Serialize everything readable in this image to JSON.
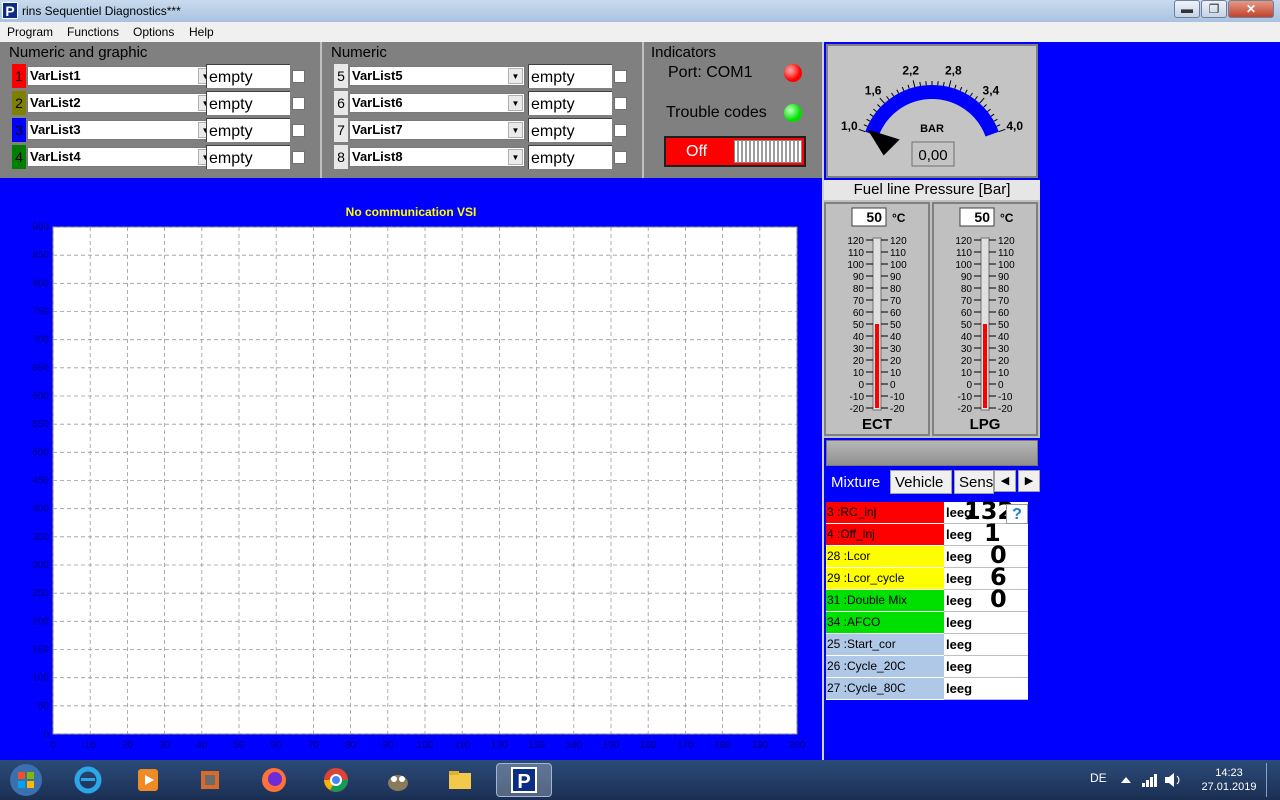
{
  "window": {
    "icon_letter": "P",
    "title": "rins Sequentiel Diagnostics***",
    "min_label": "▬",
    "max_label": "❐",
    "close_label": "✕"
  },
  "menu": [
    "Program",
    "Functions",
    "Options",
    "Help"
  ],
  "groups": {
    "numeric_graphic": {
      "title": "Numeric and graphic",
      "rows": [
        {
          "num": "1",
          "color": "#ff0000",
          "var": "VarList1",
          "value": "empty"
        },
        {
          "num": "2",
          "color": "#808000",
          "var": "VarList2",
          "value": "empty"
        },
        {
          "num": "3",
          "color": "#0000ff",
          "var": "VarList3",
          "value": "empty"
        },
        {
          "num": "4",
          "color": "#008000",
          "var": "VarList4",
          "value": "empty"
        }
      ]
    },
    "numeric": {
      "title": "Numeric",
      "rows": [
        {
          "num": "5",
          "var": "VarList5",
          "value": "empty"
        },
        {
          "num": "6",
          "var": "VarList6",
          "value": "empty"
        },
        {
          "num": "7",
          "var": "VarList7",
          "value": "empty"
        },
        {
          "num": "8",
          "var": "VarList8",
          "value": "empty"
        }
      ]
    },
    "indicators": {
      "title": "Indicators",
      "port": "Port: COM1",
      "port_led": "#ff0000",
      "trouble": "Trouble codes",
      "trouble_led": "#00e000",
      "switch_label": "Off"
    }
  },
  "chart_data": {
    "type": "line",
    "title": "No communication VSI",
    "xlim": [
      0,
      200
    ],
    "ylim": [
      0,
      900
    ],
    "x_ticks": [
      0,
      10,
      20,
      30,
      40,
      50,
      60,
      70,
      80,
      90,
      100,
      110,
      120,
      130,
      140,
      150,
      160,
      170,
      180,
      190,
      200
    ],
    "y_ticks": [
      0,
      50,
      100,
      150,
      200,
      250,
      300,
      350,
      400,
      450,
      500,
      550,
      600,
      650,
      700,
      750,
      800,
      850,
      900
    ],
    "grid": true,
    "series": []
  },
  "gauge": {
    "ticks": [
      "1,0",
      "1,6",
      "2,2",
      "2,8",
      "3,4",
      "4,0"
    ],
    "unit": "BAR",
    "value": "0,00",
    "label": "Fuel line Pressure [Bar]"
  },
  "thermometers": [
    {
      "name": "ECT",
      "value": "50",
      "unit": "°C",
      "level": 50
    },
    {
      "name": "LPG",
      "value": "50",
      "unit": "°C",
      "level": 50
    }
  ],
  "thermo_scale": [
    "120",
    "110",
    "100",
    "90",
    "80",
    "70",
    "60",
    "50",
    "40",
    "30",
    "20",
    "10",
    "0",
    "-10",
    "-20"
  ],
  "tabs": [
    "Mixture",
    "Vehicle",
    "Sens"
  ],
  "mixture_rows": [
    {
      "label": "3 :RC_inj",
      "value": "leeg",
      "color": "#ff0000"
    },
    {
      "label": "4 :Off_inj",
      "value": "leeg",
      "color": "#ff0000"
    },
    {
      "label": "28 :Lcor",
      "value": "leeg",
      "color": "#ffff00"
    },
    {
      "label": "29 :Lcor_cycle",
      "value": "leeg",
      "color": "#ffff00"
    },
    {
      "label": "31 :Double Mix",
      "value": "leeg",
      "color": "#00e000"
    },
    {
      "label": "34 :AFCO",
      "value": "leeg",
      "color": "#00e000"
    },
    {
      "label": "25 :Start_cor",
      "value": "leeg",
      "color": "#b0c8e8"
    },
    {
      "label": "26 :Cycle_20C",
      "value": "leeg",
      "color": "#b0c8e8"
    },
    {
      "label": "27 :Cycle_80C",
      "value": "leeg",
      "color": "#b0c8e8"
    }
  ],
  "big_digits": [
    "132",
    "1",
    "0",
    "6",
    "0"
  ],
  "help_label": "?",
  "tray": {
    "lang": "DE",
    "time": "14:23",
    "date": "27.01.2019"
  }
}
